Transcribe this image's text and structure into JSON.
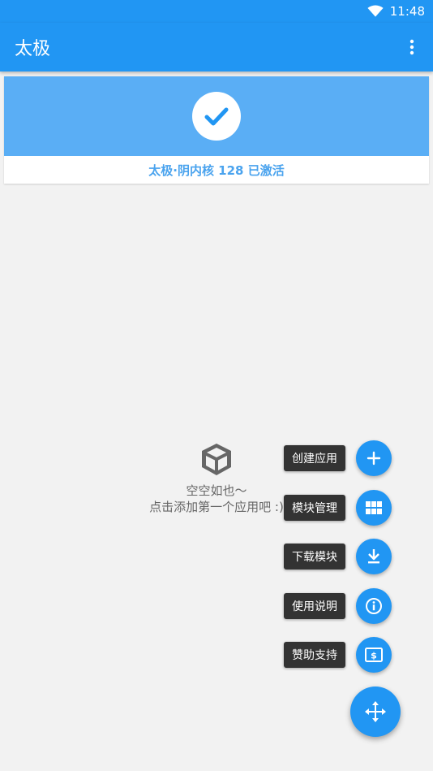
{
  "status_bar": {
    "time": "11:48"
  },
  "app_bar": {
    "title": "太极"
  },
  "status_card": {
    "label": "太极·阴内核 128 已激活",
    "accent": "#5aaef5"
  },
  "empty_state": {
    "line1": "空空如也～",
    "line2": "点击添加第一个应用吧 :)"
  },
  "fab_menu": {
    "items": [
      {
        "label": "创建应用",
        "icon": "plus-icon"
      },
      {
        "label": "模块管理",
        "icon": "grid-icon"
      },
      {
        "label": "下载模块",
        "icon": "download-icon"
      },
      {
        "label": "使用说明",
        "icon": "info-icon"
      },
      {
        "label": "赞助支持",
        "icon": "dollar-bill-icon"
      }
    ],
    "main_icon": "move-arrows-icon"
  },
  "colors": {
    "primary": "#2196f3"
  }
}
